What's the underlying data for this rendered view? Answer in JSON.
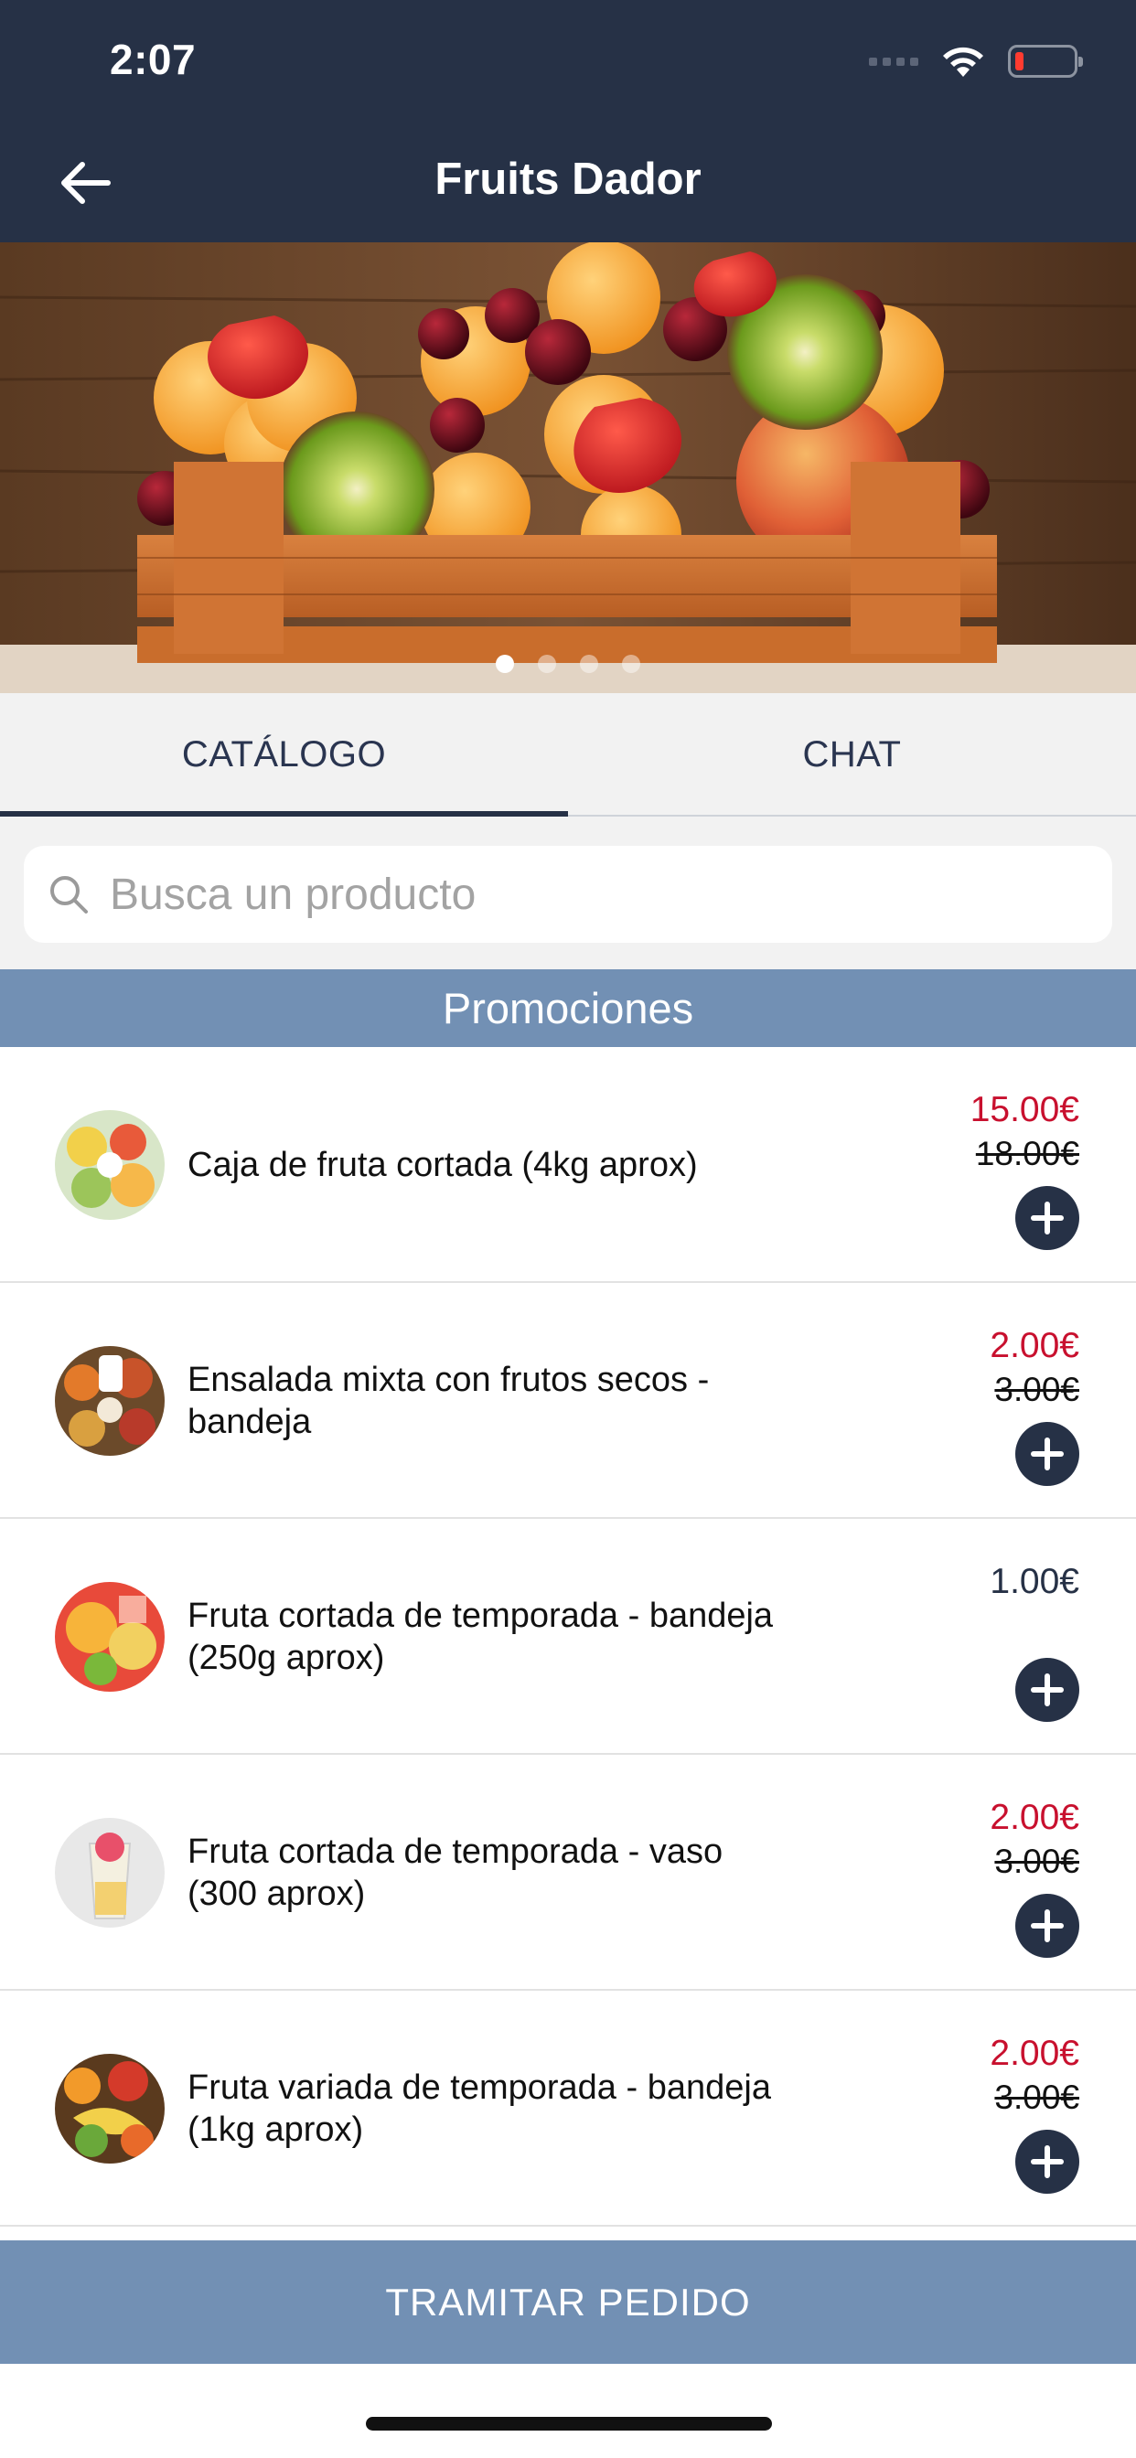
{
  "status_bar": {
    "time": "2:07"
  },
  "nav": {
    "title": "Fruits Dador"
  },
  "carousel": {
    "pages": 4,
    "active_index": 0
  },
  "tabs": [
    {
      "label": "CATÁLOGO",
      "active": true
    },
    {
      "label": "CHAT",
      "active": false
    }
  ],
  "search": {
    "placeholder": "Busca un producto",
    "value": ""
  },
  "section": {
    "title": "Promociones"
  },
  "products": [
    {
      "name": "Caja de fruta cortada (4kg aprox)",
      "price": "15.00€",
      "old_price": "18.00€",
      "on_sale": true
    },
    {
      "name": "Ensalada mixta con frutos secos - bandeja",
      "price": "2.00€",
      "old_price": "3.00€",
      "on_sale": true
    },
    {
      "name": "Fruta cortada de temporada - bandeja (250g aprox)",
      "price": "1.00€",
      "old_price": "",
      "on_sale": false
    },
    {
      "name": "Fruta cortada de temporada - vaso (300 aprox)",
      "price": "2.00€",
      "old_price": "3.00€",
      "on_sale": true
    },
    {
      "name": "Fruta variada de temporada - bandeja (1kg aprox)",
      "price": "2.00€",
      "old_price": "3.00€",
      "on_sale": true
    }
  ],
  "footer": {
    "cta_label": "TRAMITAR PEDIDO"
  },
  "colors": {
    "navy": "#263146",
    "steel_blue": "#7290b4",
    "sale_red": "#c8102e"
  }
}
